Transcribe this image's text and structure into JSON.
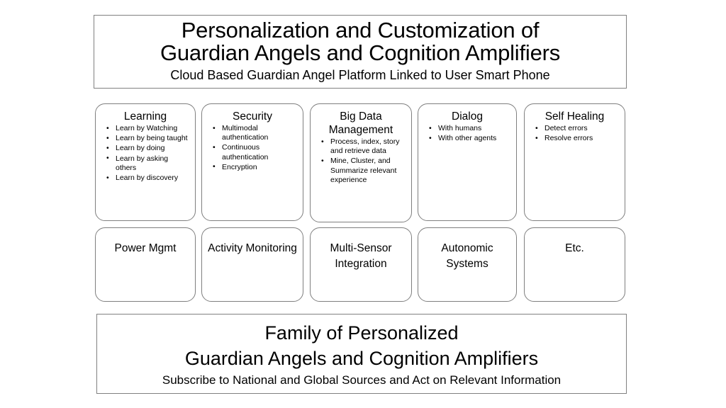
{
  "slide": {
    "background_color": "#ffffff",
    "border_color": "#808080",
    "card_border_color": "#7f7f7f",
    "text_color": "#000000"
  },
  "title_banner": {
    "line1": "Personalization and Customization of",
    "line2": "Guardian Angels and Cognition Amplifiers",
    "subtitle": "Cloud Based Guardian Angel Platform Linked to User Smart Phone"
  },
  "capability_rows": [
    {
      "row": 1,
      "cards": [
        {
          "title": "Learning",
          "bullets": [
            "Learn by Watching",
            "Learn by being taught",
            "Learn by doing",
            "Learn by asking others",
            "Learn by discovery"
          ]
        },
        {
          "title": "Security",
          "bullets": [
            "Multimodal authentication",
            "Continuous authentication",
            "Encryption"
          ]
        },
        {
          "title": "Big Data Management",
          "bullets": [
            "Process, index, story and retrieve data",
            "Mine, Cluster, and Summarize relevant experience"
          ]
        },
        {
          "title": "Dialog",
          "bullets": [
            "With humans",
            "With other agents"
          ]
        },
        {
          "title": "Self Healing",
          "bullets": [
            "Detect errors",
            "Resolve errors"
          ]
        }
      ]
    },
    {
      "row": 2,
      "cards": [
        {
          "title": "Power Mgmt",
          "bullets": []
        },
        {
          "title": "Activity Monitoring",
          "bullets": []
        },
        {
          "title": "Multi-Sensor Integration",
          "bullets": []
        },
        {
          "title": "Autonomic Systems",
          "bullets": []
        },
        {
          "title": "Etc.",
          "bullets": []
        }
      ]
    }
  ],
  "footer_banner": {
    "line1": "Family of Personalized",
    "line2": "Guardian Angels and Cognition Amplifiers",
    "subtitle": "Subscribe to National and Global Sources and Act on Relevant Information"
  }
}
